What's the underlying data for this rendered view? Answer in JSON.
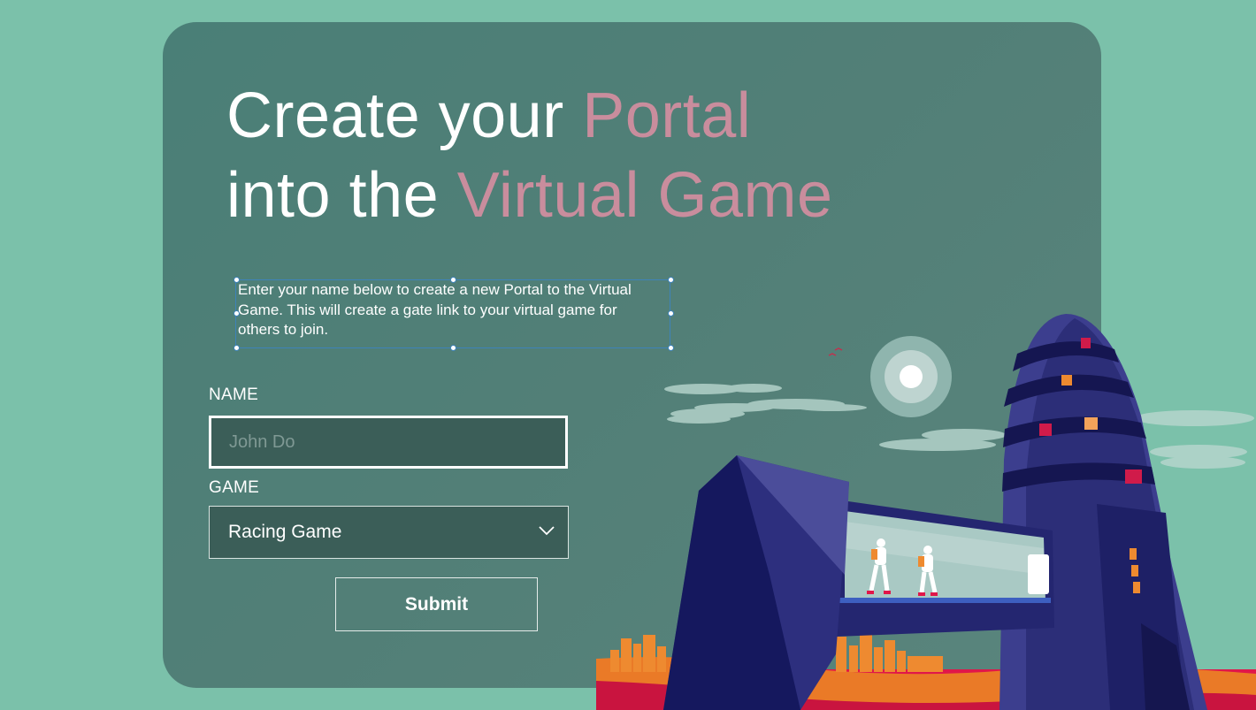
{
  "hero": {
    "title_line1_plain": "Create your ",
    "title_line1_highlight": "Portal",
    "title_line2_plain": "into the ",
    "title_line2_highlight": "Virtual Game",
    "description": "Enter your name below to create a new Portal to the Virtual Game. This will create a gate link to your virtual game for others to join."
  },
  "form": {
    "name_label": "NAME",
    "name_placeholder": "John Do",
    "name_value": "",
    "game_label": "GAME",
    "game_selected": "Racing Game",
    "submit_label": "Submit"
  },
  "icons": {
    "dropdown": "chevron-down-icon"
  },
  "colors": {
    "background": "#7bc1aa",
    "card": "#527f77",
    "highlight": "#c98d9d",
    "text": "#ffffff",
    "selection": "#3e83b9"
  }
}
